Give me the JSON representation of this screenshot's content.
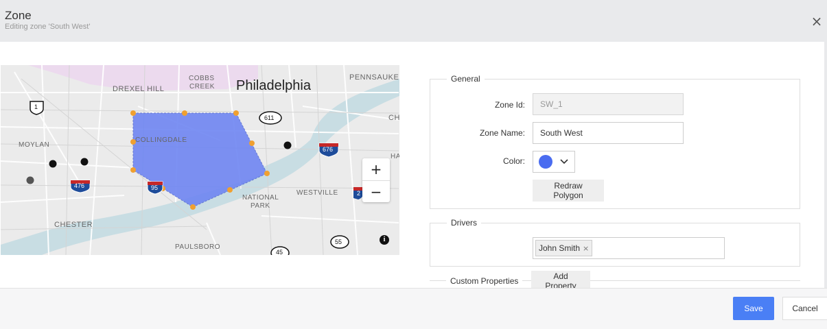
{
  "dialog": {
    "title": "Zone",
    "subtitle": "Editing zone 'South West'",
    "close_symbol": "×"
  },
  "map": {
    "city": "Philadelphia",
    "labels": {
      "drexel_hill": "DREXEL HILL",
      "cobbs_creek_1": "COBBS",
      "cobbs_creek_2": "CREEK",
      "pennsauken": "PENNSAUKEN",
      "moylan": "MOYLAN",
      "collingdale": "COLLINGDALE",
      "chester": "CHESTER",
      "national_park_1": "NATIONAL",
      "national_park_2": "PARK",
      "westville": "WESTVILLE",
      "paulsboro": "PAULSBORO",
      "ch": "CH",
      "ha": "HA"
    },
    "shields": {
      "us1": "1",
      "r611": "611",
      "i676": "676",
      "i476": "476",
      "i95": "95",
      "i2x": "2",
      "r55": "55",
      "r45": "45"
    },
    "zoom_in": "+",
    "zoom_out": "−",
    "info": "i",
    "polygon_color": "#6f86f2"
  },
  "general": {
    "legend": "General",
    "zone_id_label": "Zone Id:",
    "zone_id_value": "SW_1",
    "zone_name_label": "Zone Name:",
    "zone_name_value": "South West",
    "color_label": "Color:",
    "color_value": "#4a6cf0",
    "color_icon": "chevron-down-icon",
    "redraw_label": "Redraw Polygon"
  },
  "drivers": {
    "legend": "Drivers",
    "tags": [
      "John Smith"
    ],
    "remove_symbol": "×"
  },
  "custom": {
    "legend": "Custom Properties",
    "add_label": "Add Property"
  },
  "footer": {
    "save_label": "Save",
    "cancel_label": "Cancel",
    "accent": "#4a7ff5"
  }
}
